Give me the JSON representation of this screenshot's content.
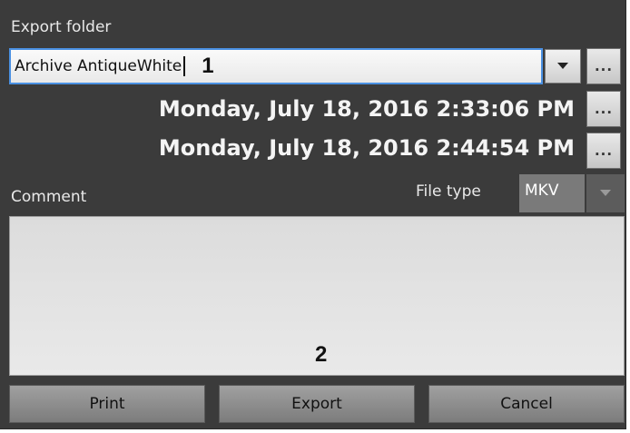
{
  "header": {
    "cropped_title_fragment": "(),"
  },
  "export_folder": {
    "label": "Export folder",
    "value": "Archive AntiqueWhite",
    "annotation_marker": "1",
    "dropdown_icon": "triangle-down-icon",
    "browse_label": "..."
  },
  "time_range": {
    "start": "Monday, July 18, 2016 2:33:06 PM",
    "end": "Monday, July 18, 2016 2:44:54 PM",
    "browse_label": "..."
  },
  "comment": {
    "label": "Comment",
    "value": "",
    "annotation_marker": "2"
  },
  "file_type": {
    "label": "File type",
    "selected": "MKV",
    "dropdown_icon": "triangle-down-icon"
  },
  "buttons": {
    "print": "Print",
    "export": "Export",
    "cancel": "Cancel"
  },
  "colors": {
    "panel_bg": "#3b3b3b",
    "focus_border": "#4a90e2"
  }
}
